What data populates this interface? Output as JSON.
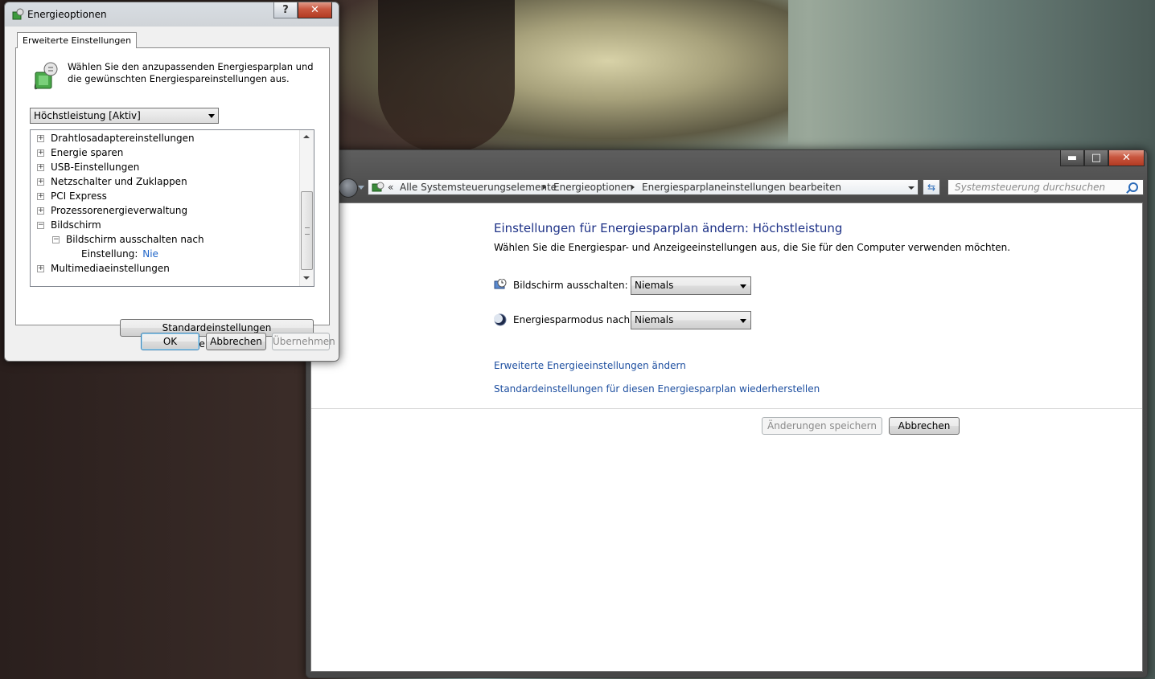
{
  "dialog": {
    "title": "Energieoptionen",
    "help_label": "?",
    "close_label": "✕",
    "tab_label": "Erweiterte Einstellungen",
    "intro_text": "Wählen Sie den anzupassenden Energiesparplan und die gewünschten Energiespareinstellungen aus.",
    "plan_selected": "Höchstleistung [Aktiv]",
    "tree": [
      {
        "label": "Drahtlosadaptereinstellungen",
        "expander": "+"
      },
      {
        "label": "Energie sparen",
        "expander": "+"
      },
      {
        "label": "USB-Einstellungen",
        "expander": "+"
      },
      {
        "label": "Netzschalter und Zuklappen",
        "expander": "+"
      },
      {
        "label": "PCI Express",
        "expander": "+"
      },
      {
        "label": "Prozessorenergieverwaltung",
        "expander": "+"
      },
      {
        "label": "Bildschirm",
        "expander": "−"
      },
      {
        "label": "Bildschirm ausschalten nach",
        "expander": "−"
      },
      {
        "label": "Einstellung:",
        "value": "Nie"
      },
      {
        "label": "Multimediaeinstellungen",
        "expander": "+"
      }
    ],
    "restore_label": "Standardeinstellungen wiederherstellen",
    "ok_label": "OK",
    "cancel_label": "Abbrechen",
    "apply_label": "Übernehmen"
  },
  "main": {
    "caption": {
      "minimize": "▬",
      "maximize": "□",
      "close": "✕"
    },
    "breadcrumb": {
      "overflow": "«",
      "items": [
        "Alle Systemsteuerungselemente",
        "Energieoptionen",
        "Energiesparplaneinstellungen bearbeiten"
      ]
    },
    "refresh_label": "⇆",
    "search_placeholder": "Systemsteuerung durchsuchen",
    "title": "Einstellungen für Energiesparplan ändern: Höchstleistung",
    "subtitle": "Wählen Sie die Energiespar- und Anzeigeeinstellungen aus, die Sie für den Computer verwenden möchten.",
    "settings": [
      {
        "label": "Bildschirm ausschalten:",
        "value": "Niemals",
        "icon": "monitor-clock-icon"
      },
      {
        "label": "Energiesparmodus nach:",
        "value": "Niemals",
        "icon": "moon-icon"
      }
    ],
    "links": [
      "Erweiterte Energieeinstellungen ändern",
      "Standardeinstellungen für diesen Energiesparplan wiederherstellen"
    ],
    "save_label": "Änderungen speichern",
    "cancel_label": "Abbrechen"
  },
  "colors": {
    "title_blue": "#1e3287",
    "link_blue": "#1e4fa0",
    "value_blue": "#1e64c8"
  }
}
